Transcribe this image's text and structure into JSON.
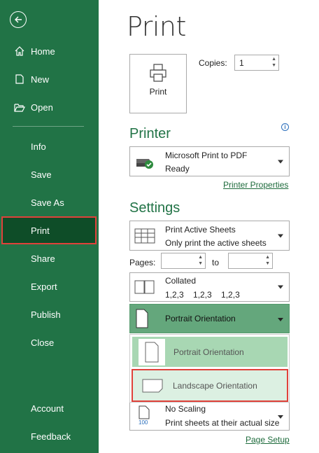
{
  "sidebar": {
    "items": [
      {
        "label": "Home",
        "icon": "home-icon"
      },
      {
        "label": "New",
        "icon": "new-document-icon"
      },
      {
        "label": "Open",
        "icon": "folder-open-icon"
      },
      {
        "label": "Info"
      },
      {
        "label": "Save"
      },
      {
        "label": "Save As"
      },
      {
        "label": "Print"
      },
      {
        "label": "Share"
      },
      {
        "label": "Export"
      },
      {
        "label": "Publish"
      },
      {
        "label": "Close"
      },
      {
        "label": "Account"
      },
      {
        "label": "Feedback"
      }
    ],
    "active": "Print"
  },
  "page": {
    "title": "Print",
    "print_button_label": "Print",
    "copies_label": "Copies:",
    "copies_value": "1"
  },
  "printer": {
    "section_title": "Printer",
    "name": "Microsoft Print to PDF",
    "status": "Ready",
    "properties_link": "Printer Properties"
  },
  "settings": {
    "section_title": "Settings",
    "print_what": {
      "title": "Print Active Sheets",
      "subtitle": "Only print the active sheets"
    },
    "pages_label": "Pages:",
    "to_label": "to",
    "collation": {
      "title": "Collated",
      "subtitle": "1,2,3    1,2,3    1,2,3"
    },
    "orientation_selected": "Portrait Orientation",
    "orientation_options": [
      "Portrait Orientation",
      "Landscape Orientation"
    ],
    "scaling": {
      "title": "No Scaling",
      "subtitle": "Print sheets at their actual size",
      "icon_text": "100"
    },
    "page_setup_link": "Page Setup"
  },
  "colors": {
    "sidebar_bg": "#217346",
    "active_bg": "#0e4d28",
    "highlight_border": "#e0413a",
    "accent_green": "#217346"
  }
}
